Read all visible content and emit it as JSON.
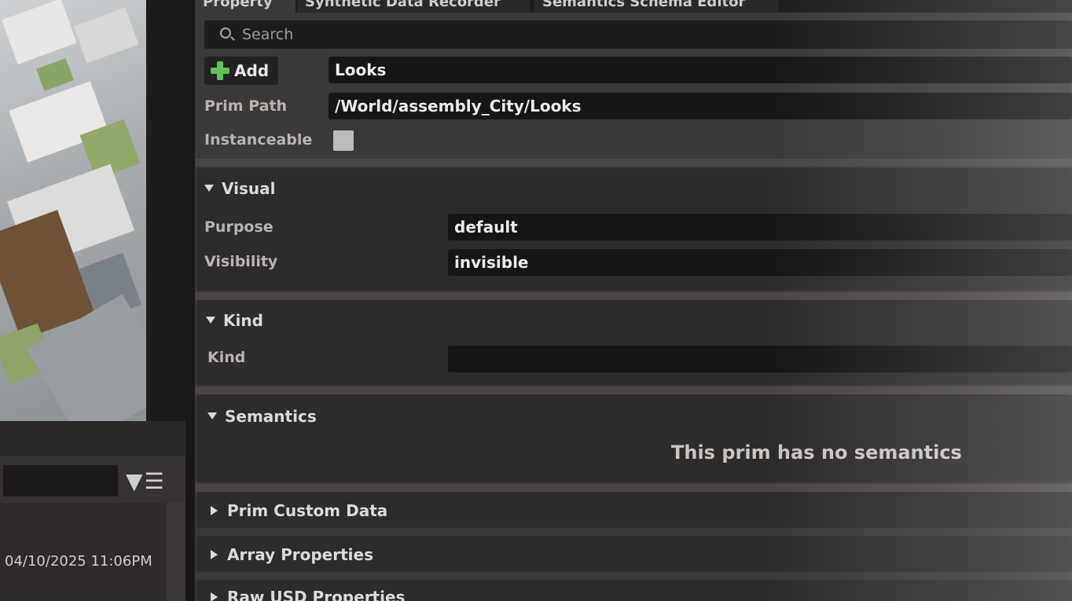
{
  "tabs": [
    "Property",
    "Synthetic Data Recorder",
    "Semantics Schema Editor"
  ],
  "search": {
    "placeholder": "Search"
  },
  "add_button": "Add",
  "name_field": "Looks",
  "prim_path": {
    "label": "Prim Path",
    "value": "/World/assembly_City/Looks"
  },
  "instanceable": {
    "label": "Instanceable",
    "checked": false
  },
  "visual": {
    "title": "Visual",
    "purpose": {
      "label": "Purpose",
      "value": "default"
    },
    "visibility": {
      "label": "Visibility",
      "value": "invisible"
    }
  },
  "kind": {
    "title": "Kind",
    "field": {
      "label": "Kind",
      "value": ""
    }
  },
  "semantics": {
    "title": "Semantics",
    "message": "This prim has no semantics"
  },
  "collapsed_sections": [
    "Prim Custom Data",
    "Array Properties",
    "Raw USD Properties"
  ],
  "stage": {
    "timestamp": "04/10/2025 11:06PM"
  },
  "colors": {
    "accent_green": "#5ec255",
    "panel_bg": "#3b3838",
    "field_bg": "#171515"
  }
}
